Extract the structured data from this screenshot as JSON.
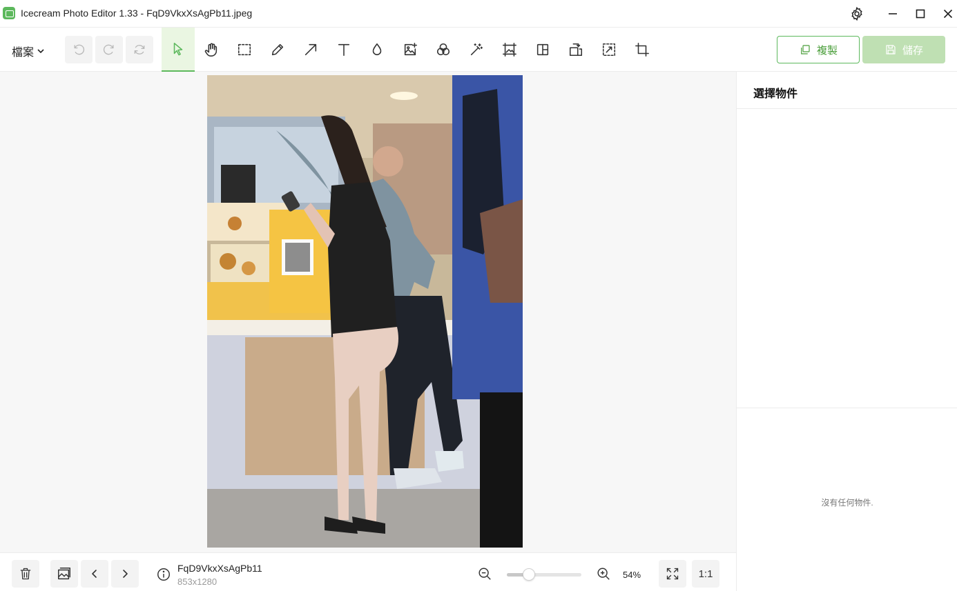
{
  "window": {
    "title": "Icecream Photo Editor 1.33 - FqD9VkxXsAgPb11.jpeg"
  },
  "toolbar": {
    "file_menu_label": "檔案",
    "copy_label": "複製",
    "save_label": "儲存",
    "active_tool": "select",
    "tools": [
      "select-tool",
      "hand-tool",
      "marquee-tool",
      "pen-tool",
      "arrow-tool",
      "text-tool",
      "blur-tool",
      "add-image-tool",
      "filters-tool",
      "magic-tool",
      "resize-tool",
      "collage-tool",
      "rotate-tool",
      "crop-region-tool",
      "crop-tool"
    ]
  },
  "side_panel": {
    "title": "選擇物件",
    "empty_text": "沒有任何物件."
  },
  "bottom_bar": {
    "file_name": "FqD9VkxXsAgPb11",
    "file_dims": "853x1280",
    "zoom_percent": "54%",
    "zoom_slider_value": 0.26,
    "ratio_label": "1:1"
  },
  "colors": {
    "accent": "#5cb85c",
    "accent_dark": "#4a9e3a",
    "save_disabled": "#bfe0b3",
    "canvas_bg": "#f7f7f7"
  }
}
